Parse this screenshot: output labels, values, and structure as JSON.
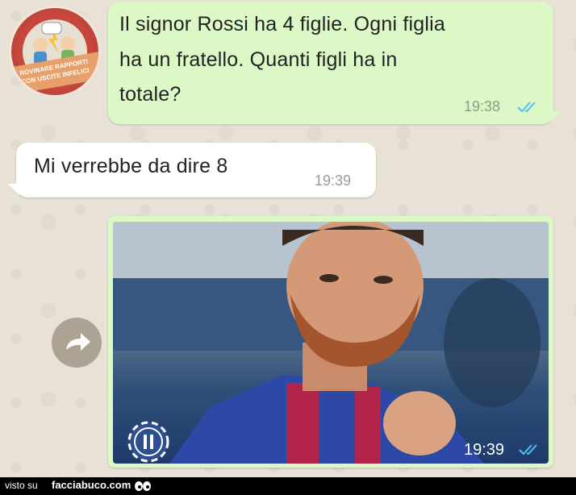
{
  "badge": {
    "text_top": "ROVINARE RAPPORTI",
    "text_bottom": "CON USCITE INFELICI"
  },
  "messages": [
    {
      "direction": "outgoing",
      "lines": [
        "Il signor Rossi ha 4 figlie. Ogni figlia",
        "ha un fratello. Quanti figli ha in",
        "totale?"
      ],
      "time": "19:38",
      "status": "read"
    },
    {
      "direction": "incoming",
      "lines": [
        "Mi verrebbe da dire 8"
      ],
      "time": "19:39"
    },
    {
      "direction": "outgoing",
      "type": "image",
      "time": "19:39",
      "status": "read"
    }
  ],
  "icons": {
    "share": "forward-arrow-icon",
    "media": "gif-pause-icon",
    "ticks": "double-check-icon"
  },
  "footer": {
    "visto": "visto su",
    "site": "facciabuco.com"
  },
  "colors": {
    "outgoing_bubble": "#dcf8c6",
    "incoming_bubble": "#ffffff",
    "read_ticks": "#4fc3f7"
  }
}
